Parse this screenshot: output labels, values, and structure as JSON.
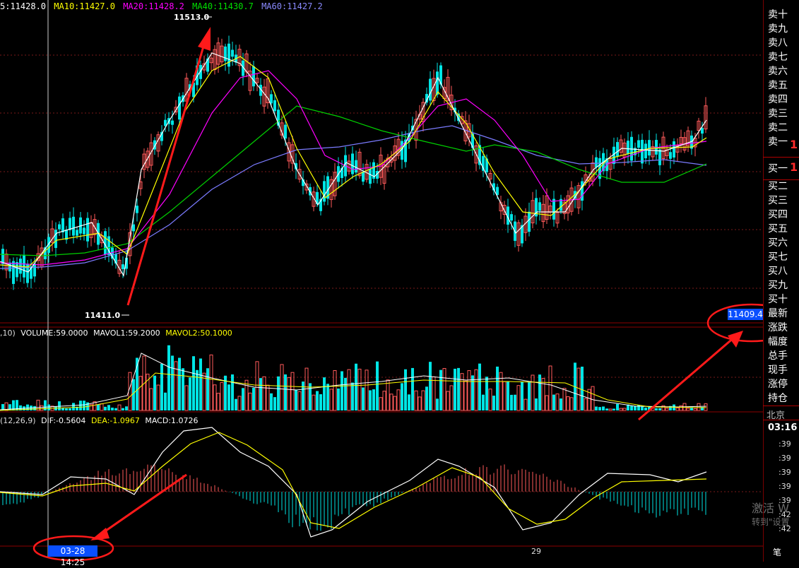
{
  "header": {
    "ma5": "5:11428.0",
    "ma10": "MA10:11427.0",
    "ma20": "MA20:11428.2",
    "ma40": "MA40:11430.7",
    "ma60": "MA60:11427.2"
  },
  "price_labels": {
    "high": "11513.0",
    "low": "11411.0",
    "current": "11409.4"
  },
  "volume_header": {
    "prefix": ",10)",
    "volume": "VOLUME:59.0000",
    "mavol1": "MAVOL1:59.2000",
    "mavol2": "MAVOL2:50.1000"
  },
  "macd_header": {
    "prefix": "(12,26,9)",
    "dif": "DIF:-0.5604",
    "dea": "DEA:-1.0967",
    "macd": "MACD:1.0726"
  },
  "time_axis": {
    "cursor_time": "03-28 14:25",
    "day_label": "29"
  },
  "order_book": {
    "sell": [
      "卖十",
      "卖九",
      "卖八",
      "卖七",
      "卖六",
      "卖五",
      "卖四",
      "卖三",
      "卖二",
      "卖一"
    ],
    "buy": [
      "买一",
      "买二",
      "买三",
      "买四",
      "买五",
      "买六",
      "买七",
      "买八",
      "买九",
      "买十"
    ],
    "sell1_value": "1",
    "buy1_value": "1",
    "stats": [
      "最新",
      "涨跌",
      "幅度",
      "总手",
      "现手",
      "涨停",
      "持仓"
    ]
  },
  "trades": {
    "location": "北京",
    "time": "03:16",
    "rows": [
      ":39",
      ":39",
      ":39",
      ":39",
      ":39",
      ":42",
      ":42"
    ],
    "footer": "笔"
  },
  "watermark": {
    "line1": "激活 W",
    "line2": "转到\"设置"
  },
  "colors": {
    "up": "#ff5a5a",
    "down": "#00e5e5",
    "ma5": "#ffffff",
    "ma10": "#ffff00",
    "ma20": "#ff00ff",
    "ma40": "#00d000",
    "ma60": "#7b7bff",
    "annotation": "#ff1a1a",
    "highlight": "#0a4fff"
  }
}
